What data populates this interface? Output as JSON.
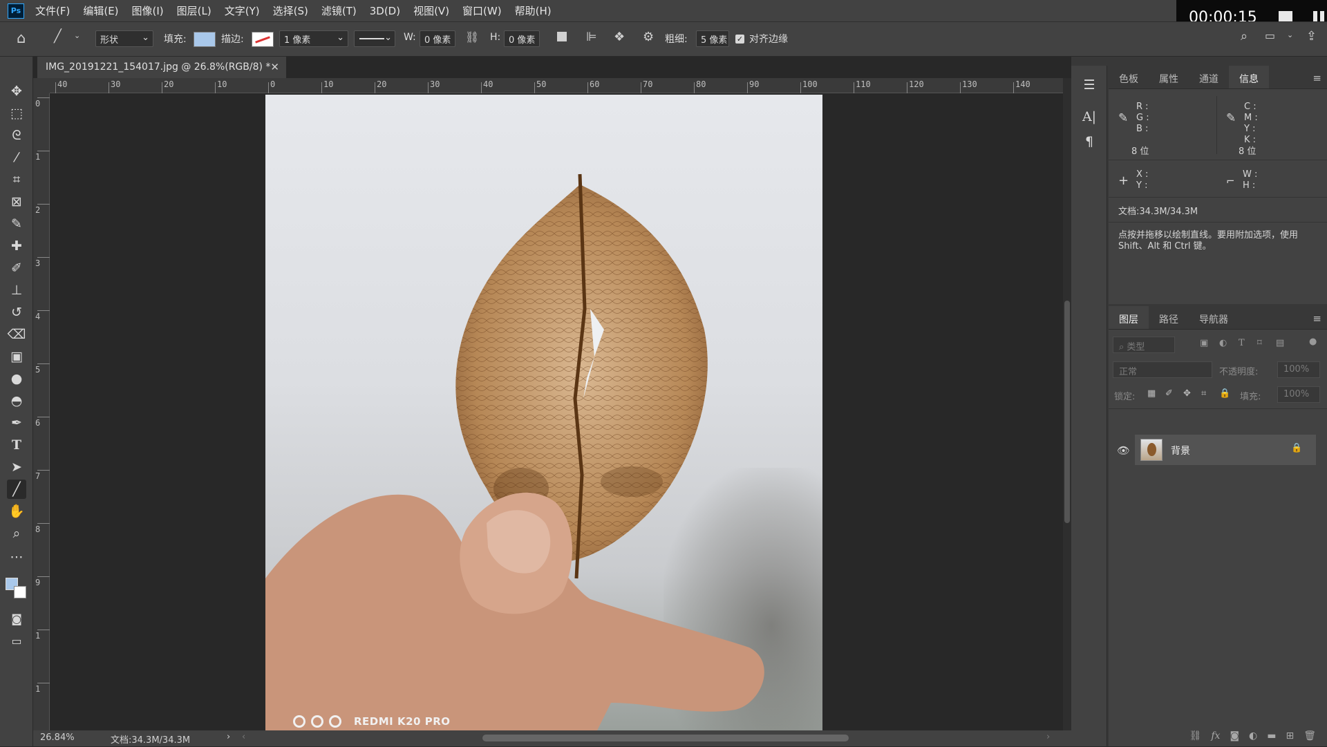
{
  "app": {
    "logo": "Ps",
    "menus": [
      "文件(F)",
      "编辑(E)",
      "图像(I)",
      "图层(L)",
      "文字(Y)",
      "选择(S)",
      "滤镜(T)",
      "3D(D)",
      "视图(V)",
      "窗口(W)",
      "帮助(H)"
    ]
  },
  "recorder": {
    "time": "00:00:15"
  },
  "options": {
    "mode": "形状",
    "fill_label": "填充:",
    "stroke_label": "描边:",
    "stroke_width": "1 像素",
    "w_label": "W:",
    "w_value": "0 像素",
    "h_label": "H:",
    "h_value": "0 像素",
    "weight_label": "粗细:",
    "weight_value": "5 像素",
    "align_edges_label": "对齐边缘",
    "align_edges_checked": true,
    "fill_color": "#a9c8ea"
  },
  "document": {
    "tab_title": "IMG_20191221_154017.jpg @ 26.8%(RGB/8) *",
    "watermark": "REDMI K20 PRO"
  },
  "rulers": {
    "h": [
      "40",
      "30",
      "20",
      "10",
      "0",
      "10",
      "20",
      "30",
      "40",
      "50",
      "60",
      "70",
      "80",
      "90",
      "100",
      "110",
      "120",
      "130",
      "140"
    ],
    "v": [
      "0",
      "1",
      "2",
      "3",
      "4",
      "5",
      "6",
      "7",
      "8",
      "9",
      "1",
      "1",
      "1"
    ]
  },
  "status": {
    "zoom": "26.84%",
    "doc": "文档:34.3M/34.3M"
  },
  "info_panel": {
    "tabs": [
      "色板",
      "属性",
      "通道",
      "信息"
    ],
    "active_tab": "信息",
    "rgb_labels": [
      "R :",
      "G :",
      "B :"
    ],
    "cmyk_labels": [
      "C :",
      "M :",
      "Y :",
      "K :"
    ],
    "bits_left": "8 位",
    "bits_right": "8 位",
    "xy_labels": [
      "X :",
      "Y :"
    ],
    "wh_labels": [
      "W :",
      "H :"
    ],
    "doc_size": "文档:34.3M/34.3M",
    "hint": "点按并拖移以绘制直线。要用附加选项，使用 Shift、Alt 和 Ctrl 键。"
  },
  "layers_panel": {
    "tabs": [
      "图层",
      "路径",
      "导航器"
    ],
    "active_tab": "图层",
    "filter_placeholder": "类型",
    "blend_mode": "正常",
    "opacity_label": "不透明度:",
    "opacity_value": "100%",
    "lock_label": "锁定:",
    "fill_label": "填充:",
    "fill_value": "100%",
    "layers": [
      {
        "name": "背景",
        "visible": true,
        "locked": true
      }
    ]
  }
}
